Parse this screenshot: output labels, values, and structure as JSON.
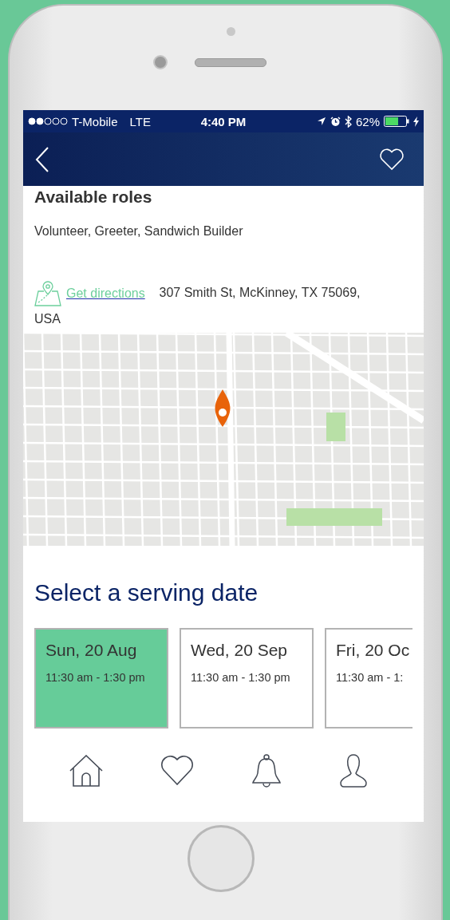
{
  "status_bar": {
    "carrier": "T-Mobile",
    "network": "LTE",
    "time": "4:40 PM",
    "battery": "62%"
  },
  "header": {
    "favorite": false
  },
  "roles": {
    "title": "Available roles",
    "text": "Volunteer, Greeter, Sandwich Builder"
  },
  "location": {
    "link": "Get directions",
    "address": "307 Smith St, McKinney, TX 75069, USA"
  },
  "dates": {
    "title": "Select a serving date",
    "items": [
      {
        "date": "Sun, 20 Aug",
        "time": "11:30 am - 1:30 pm",
        "selected": true
      },
      {
        "date": "Wed, 20 Sep",
        "time": "11:30 am - 1:30 pm",
        "selected": false
      },
      {
        "date": "Fri, 20 Oc",
        "time": "11:30 am - 1:",
        "selected": false
      }
    ]
  },
  "nav": [
    {
      "kind": "home",
      "selected": false
    },
    {
      "kind": "favorites",
      "selected": false
    },
    {
      "kind": "notifications",
      "selected": false
    },
    {
      "kind": "profile",
      "selected": false
    }
  ]
}
